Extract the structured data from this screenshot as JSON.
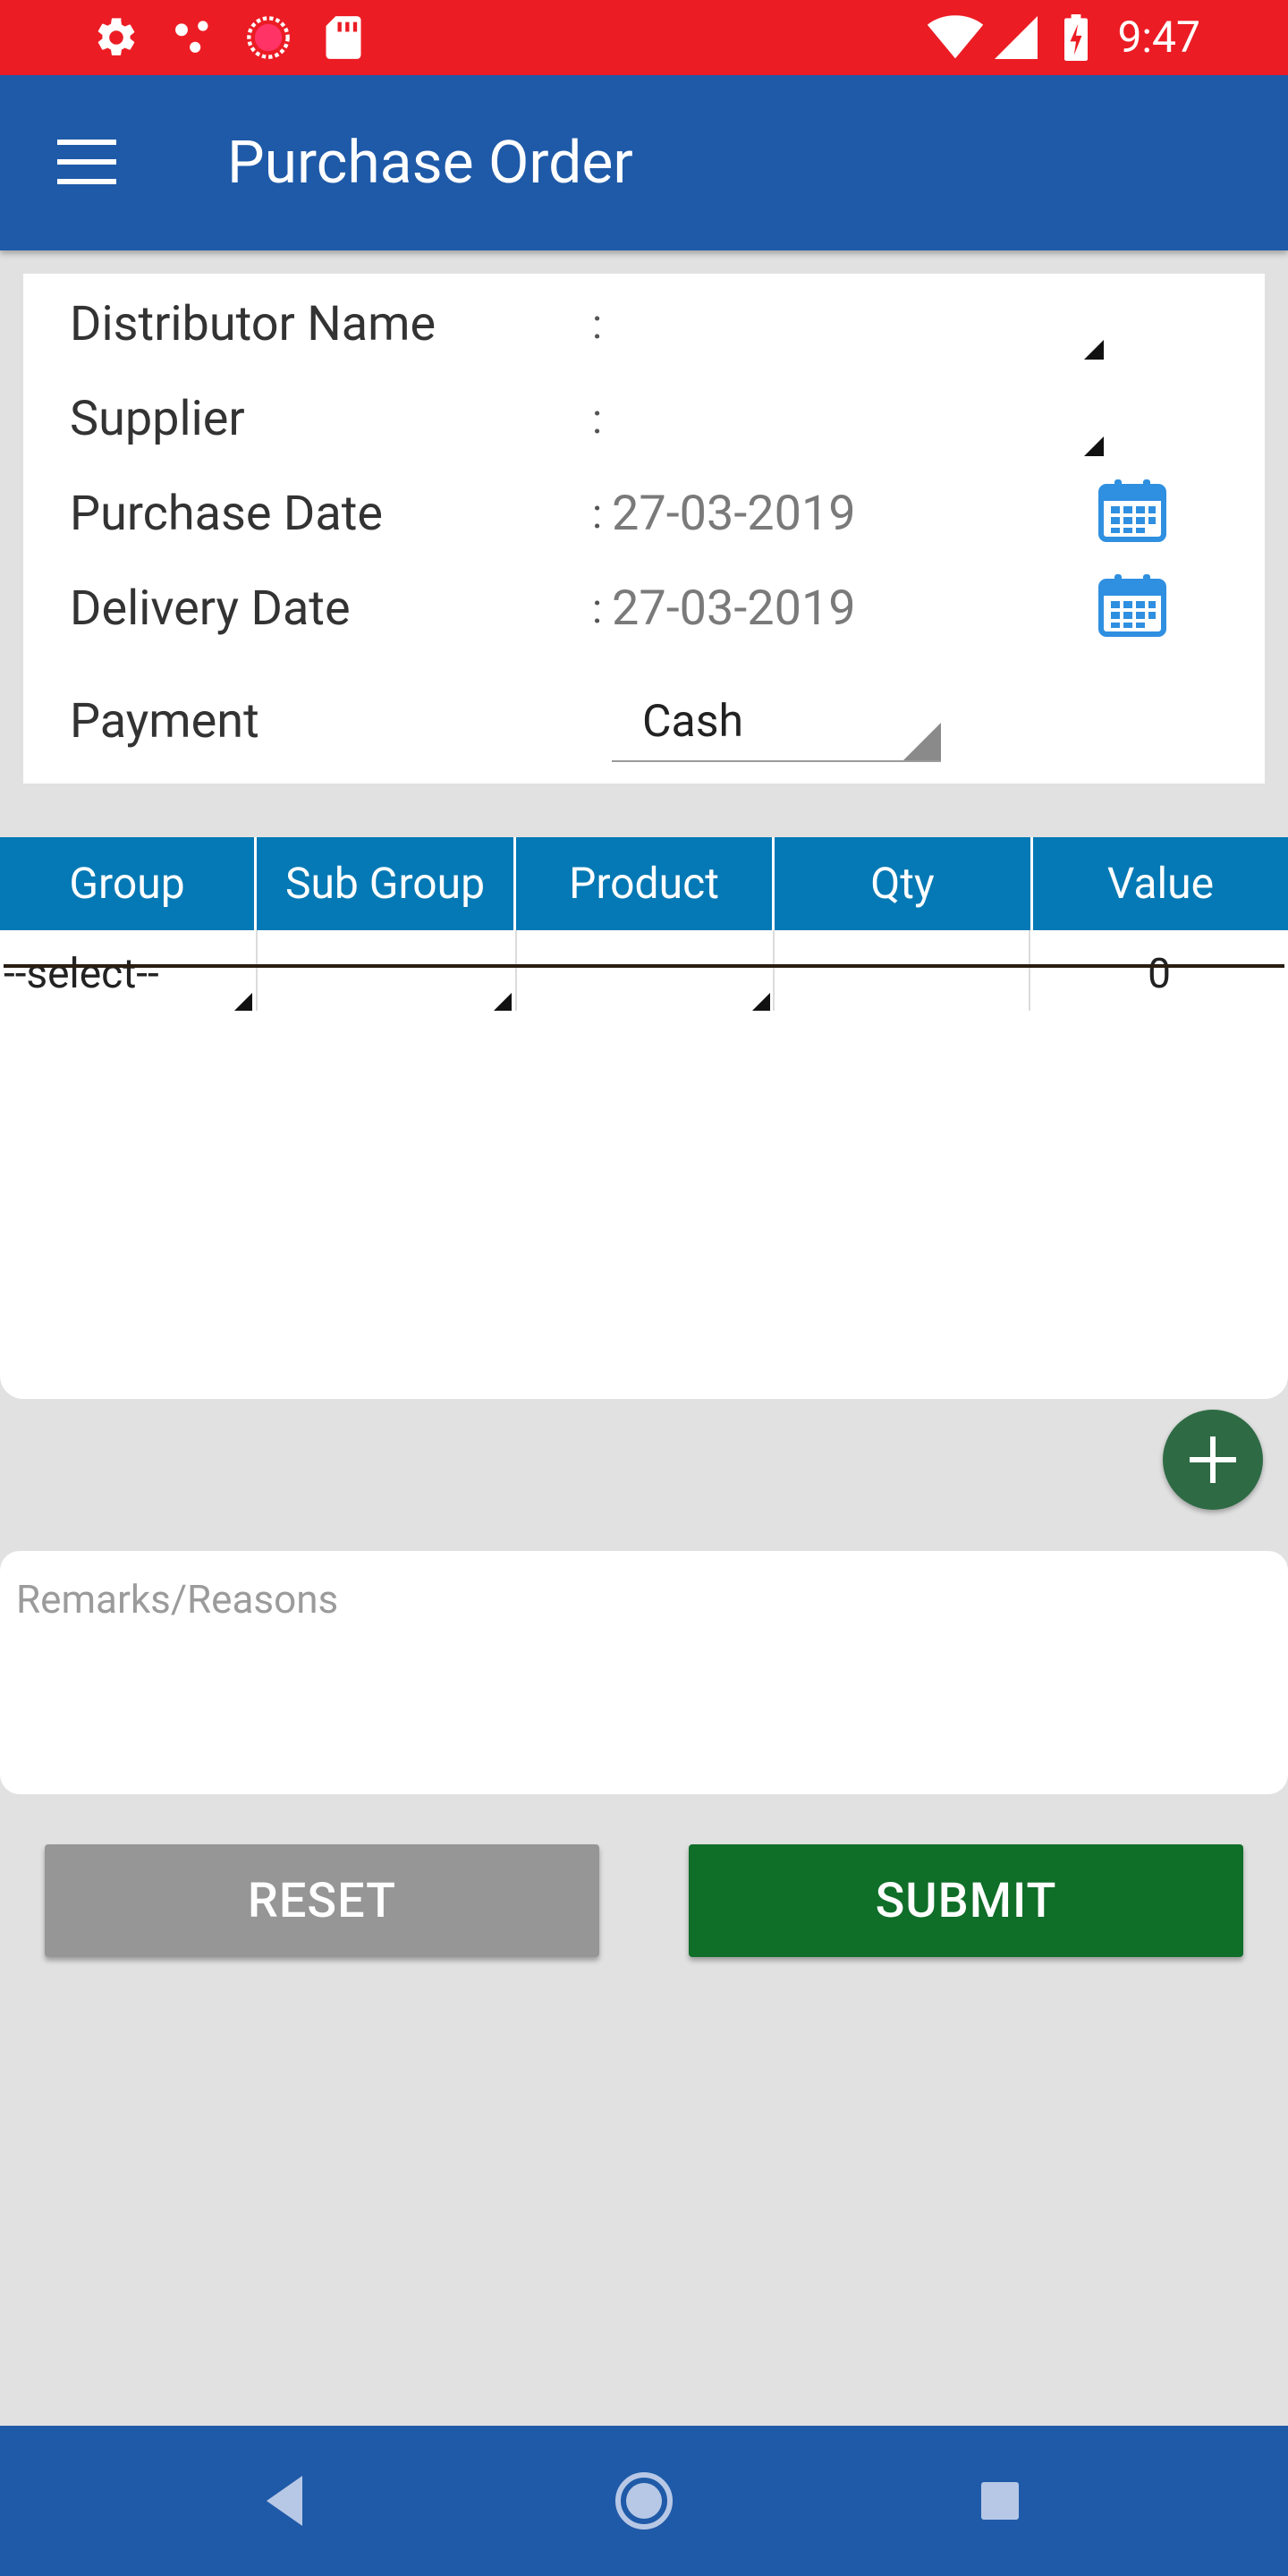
{
  "status_bar": {
    "time": "9:47",
    "background": "#ec1c24",
    "left_icons": [
      "settings-icon",
      "share-dots-icon",
      "recorder-icon",
      "sd-card-icon"
    ],
    "right_icons": [
      "wifi-icon",
      "signal-icon",
      "battery-charging-icon"
    ]
  },
  "app_bar": {
    "title": "Purchase Order",
    "background": "#1f5aa8",
    "menu_icon": "hamburger-menu-icon"
  },
  "form": {
    "distributor_name": {
      "label": "Distributor Name",
      "colon": ":",
      "value": ""
    },
    "supplier": {
      "label": "Supplier",
      "colon": ":",
      "value": ""
    },
    "purchase_date": {
      "label": "Purchase Date",
      "colon": ":",
      "value": "27-03-2019",
      "icon": "calendar-icon"
    },
    "delivery_date": {
      "label": "Delivery Date",
      "colon": ":",
      "value": "27-03-2019",
      "icon": "calendar-icon"
    },
    "payment": {
      "label": "Payment",
      "selected": "Cash"
    }
  },
  "table": {
    "header_color": "#0579b5",
    "columns": [
      "Group",
      "Sub Group",
      "Product",
      "Qty",
      "Value"
    ],
    "rows": [
      {
        "group": "--select--",
        "sub_group": "",
        "product": "",
        "qty": "",
        "value": "0"
      }
    ]
  },
  "add_button": {
    "icon": "plus-icon",
    "color": "#2e6b45"
  },
  "remarks": {
    "placeholder": "Remarks/Reasons",
    "value": ""
  },
  "buttons": {
    "reset_label": "RESET",
    "reset_color": "#969696",
    "submit_label": "SUBMIT",
    "submit_color": "#0f6e28"
  },
  "nav_bar": {
    "icons": [
      "back-icon",
      "home-icon",
      "recents-icon"
    ]
  }
}
